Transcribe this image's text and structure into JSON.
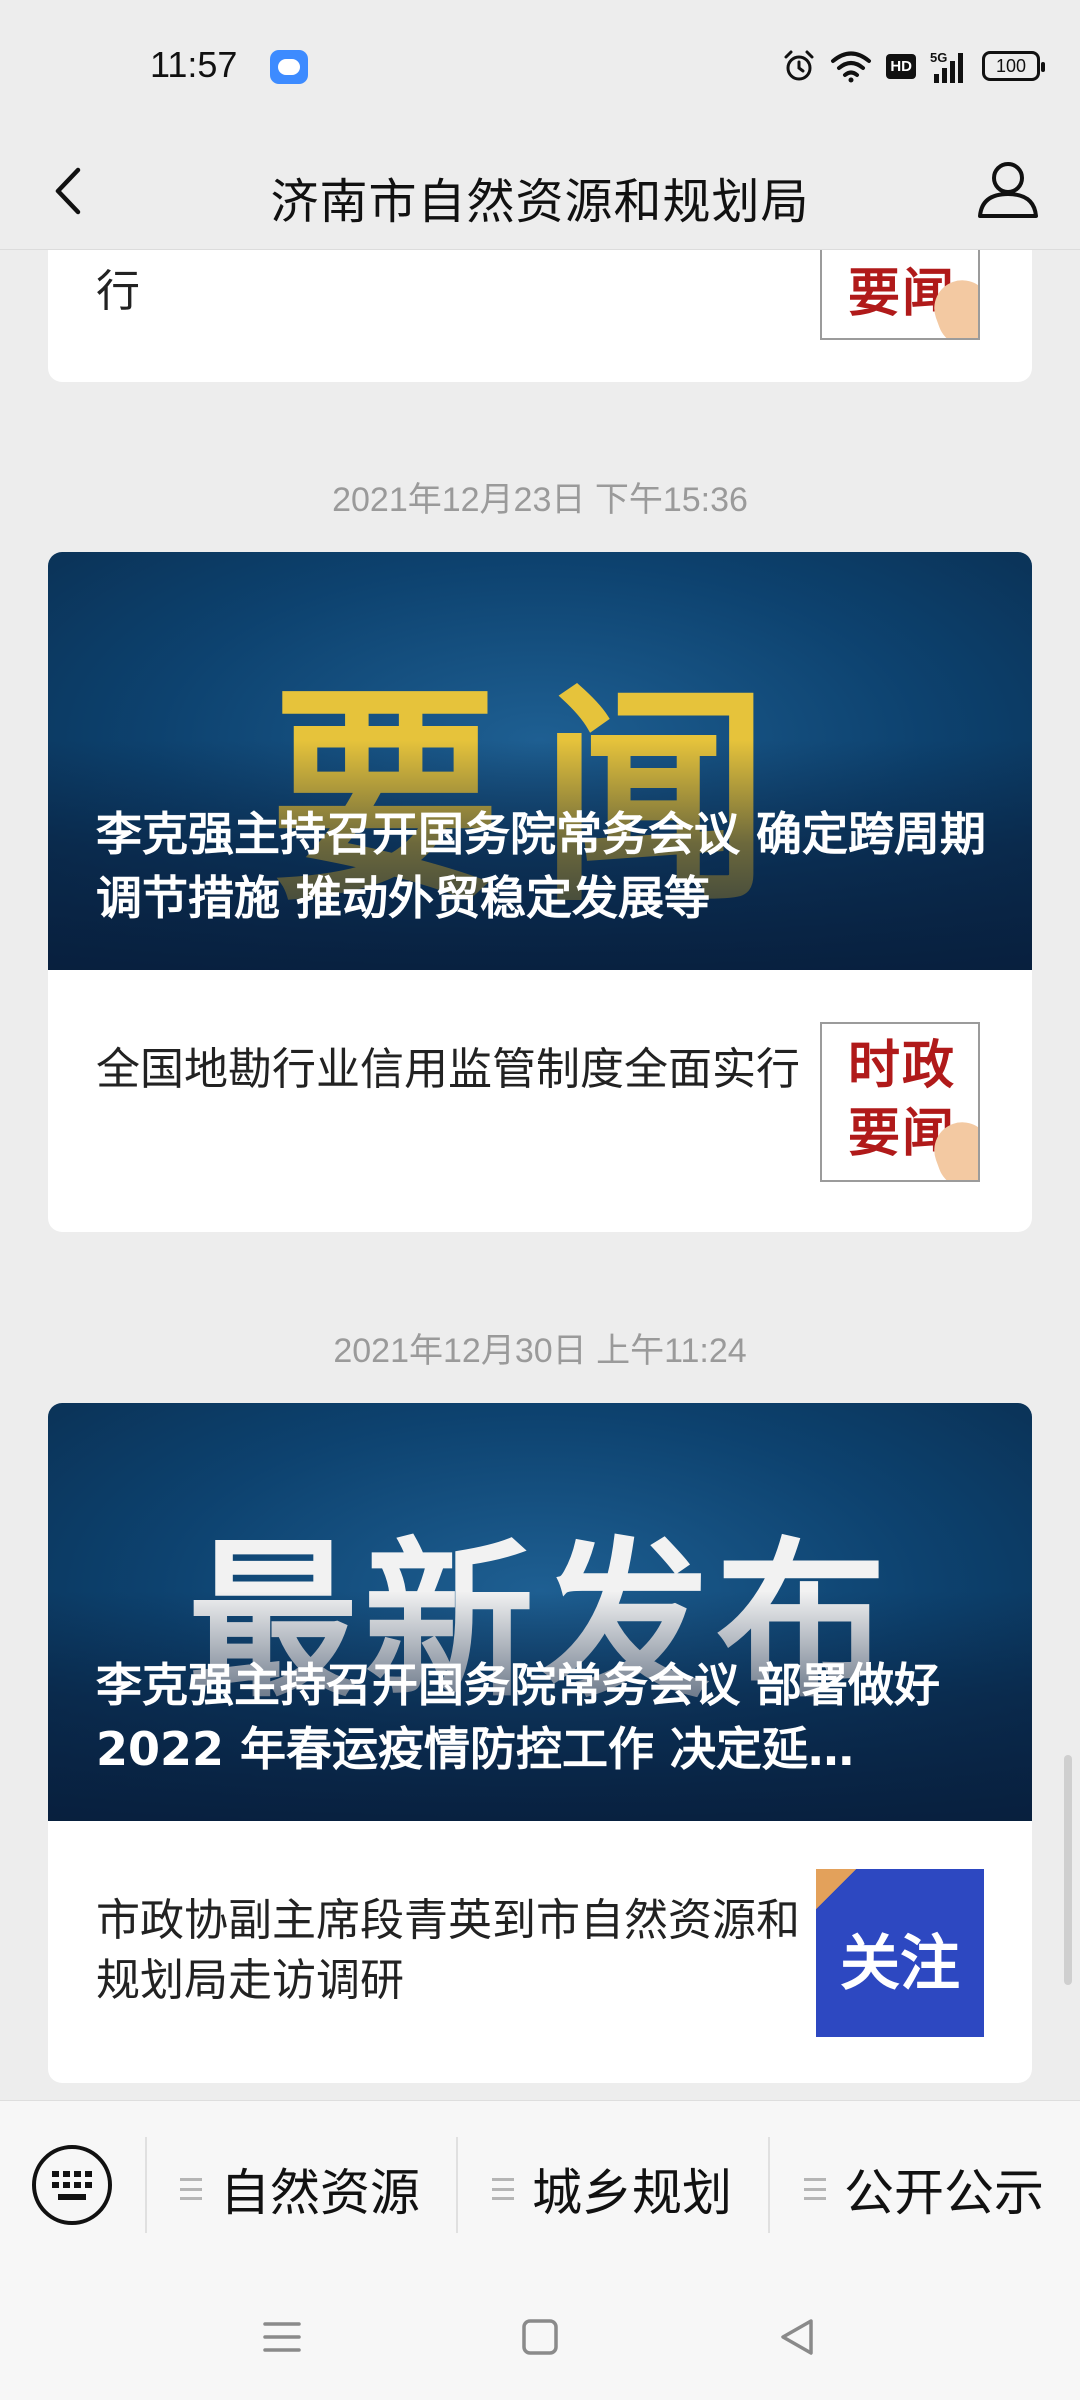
{
  "status_bar": {
    "time": "11:57",
    "network": "5G",
    "hd_label": "HD",
    "battery": "100",
    "icons": [
      "cloud-app-icon",
      "alarm-icon",
      "wifi-icon",
      "hd-icon",
      "signal-icon",
      "battery-icon"
    ]
  },
  "header": {
    "title": "济南市自然资源和规划局",
    "back_icon": "chevron-left-icon",
    "profile_icon": "person-icon"
  },
  "feed": {
    "top_partial_item": {
      "text": "行",
      "thumb_text": "要闻"
    },
    "groups": [
      {
        "timestamp": "2021年12月23日 下午15:36",
        "banner": {
          "big_text": "要闻",
          "title": "李克强主持召开国务院常务会议 确定跨周期调节措施 推动外贸稳定发展等"
        },
        "item": {
          "text": "全国地勘行业信用监管制度全面实行",
          "thumb_text": "时政要闻"
        }
      },
      {
        "timestamp": "2021年12月30日 上午11:24",
        "banner": {
          "big_text": "最新发布",
          "title": "李克强主持召开国务院常务会议 部署做好 2022 年春运疫情防控工作 决定延…"
        },
        "item": {
          "text": "市政协副主席段青英到市自然资源和规划局走访调研",
          "thumb_text": "关注"
        }
      }
    ]
  },
  "bottom_menu": {
    "keyboard_icon": "keyboard-icon",
    "items": [
      "自然资源",
      "城乡规划",
      "公开公示"
    ]
  },
  "system_nav": {
    "icons": [
      "menu-icon",
      "home-square-icon",
      "back-triangle-icon"
    ]
  },
  "colors": {
    "background": "#ededed",
    "banner_blue": "#0d426f",
    "banner_yellow": "#e6c33b",
    "thumb_red": "#b01a1a",
    "follow_blue": "#2d48c1"
  }
}
